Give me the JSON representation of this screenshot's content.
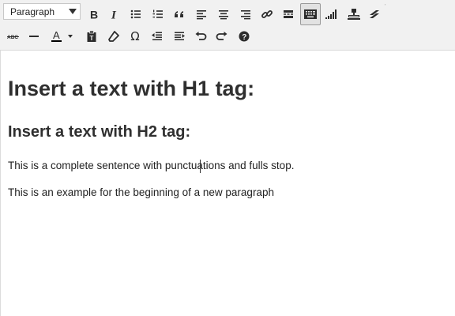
{
  "toolbar": {
    "format_select": {
      "value": "Paragraph"
    },
    "row1": [
      {
        "name": "bold-button",
        "icon": "bold-icon"
      },
      {
        "name": "italic-button",
        "icon": "italic-icon"
      },
      {
        "name": "bullet-list-button",
        "icon": "bullet-list-icon"
      },
      {
        "name": "numbered-list-button",
        "icon": "numbered-list-icon"
      },
      {
        "name": "blockquote-button",
        "icon": "blockquote-icon"
      },
      {
        "name": "align-left-button",
        "icon": "align-left-icon"
      },
      {
        "name": "align-center-button",
        "icon": "align-center-icon"
      },
      {
        "name": "align-right-button",
        "icon": "align-right-icon"
      },
      {
        "name": "insert-link-button",
        "icon": "link-icon"
      },
      {
        "name": "read-more-button",
        "icon": "read-more-icon"
      },
      {
        "name": "toolbar-toggle-button",
        "icon": "keyboard-icon",
        "active": true
      },
      {
        "name": "signal-chart-button",
        "icon": "bar-chart-icon"
      },
      {
        "name": "stamp-button",
        "icon": "stamp-icon"
      },
      {
        "name": "plugin-button",
        "icon": "lightning-icon"
      }
    ],
    "row2": [
      {
        "name": "strikethrough-button",
        "icon": "strikethrough-icon",
        "label": "ABC"
      },
      {
        "name": "horizontal-line-button",
        "icon": "horizontal-line-icon"
      },
      {
        "name": "text-color-button",
        "icon": "text-color-icon",
        "label": "A"
      },
      {
        "name": "paste-as-text-button",
        "icon": "clipboard-icon"
      },
      {
        "name": "clear-formatting-button",
        "icon": "eraser-icon"
      },
      {
        "name": "special-character-button",
        "icon": "omega-icon",
        "label": "Ω"
      },
      {
        "name": "outdent-button",
        "icon": "outdent-icon"
      },
      {
        "name": "indent-button",
        "icon": "indent-icon"
      },
      {
        "name": "undo-button",
        "icon": "undo-icon"
      },
      {
        "name": "redo-button",
        "icon": "redo-icon"
      },
      {
        "name": "help-button",
        "icon": "help-icon",
        "label": "?"
      }
    ]
  },
  "editor": {
    "h1": "Insert a text with H1 tag:",
    "h2": "Insert a text with H2 tag:",
    "paragraphs": [
      "This is a complete sentence with punctuations and fulls stop.",
      "This is an example for the beginning of a new paragraph"
    ]
  },
  "colors": {
    "toolbar_bg": "#f1f1f1",
    "icon": "#2c2c2c",
    "text_color_underline": "#000000"
  }
}
